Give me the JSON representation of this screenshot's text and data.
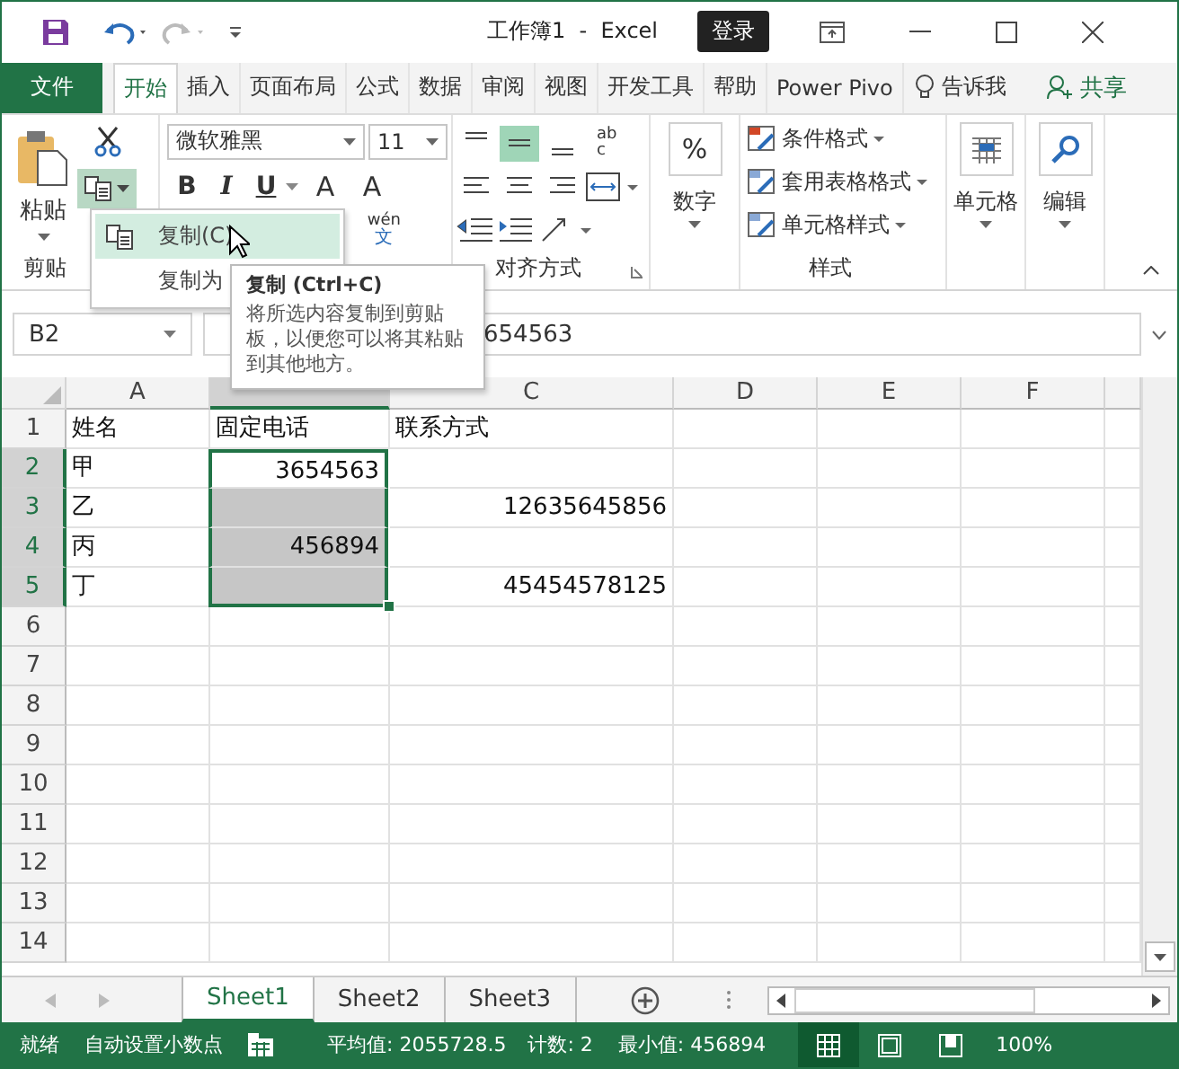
{
  "title_bar": {
    "title": "工作簿1  -  Excel",
    "sign_in": "登录"
  },
  "file_tab": "文件",
  "tabs": [
    {
      "label": "开始",
      "selected": true
    },
    {
      "label": "插入",
      "selected": false
    },
    {
      "label": "页面布局",
      "selected": false
    },
    {
      "label": "公式",
      "selected": false
    },
    {
      "label": "数据",
      "selected": false
    },
    {
      "label": "审阅",
      "selected": false
    },
    {
      "label": "视图",
      "selected": false
    },
    {
      "label": "开发工具",
      "selected": false
    },
    {
      "label": "帮助",
      "selected": false
    },
    {
      "label": "Power Pivo",
      "selected": false
    }
  ],
  "tell_me": "告诉我",
  "share": "共享",
  "ribbon": {
    "paste": "粘贴",
    "clipboard_label": "剪贴",
    "font_name": "微软雅黑",
    "font_size": "11",
    "font_buttons": [
      "B",
      "I",
      "U"
    ],
    "grow_font": "A",
    "shrink_font": "A",
    "phonetic": [
      "wén",
      "文"
    ],
    "wrap_text": [
      "ab",
      "c"
    ],
    "vertical_align": [
      {
        "selected": false
      },
      {
        "selected": true
      },
      {
        "selected": false
      }
    ],
    "alignment_label": "对齐方式",
    "percent": "%",
    "number": "数字",
    "styles": [
      "条件格式",
      "套用表格格式",
      "单元格样式"
    ],
    "styles_label": "样式",
    "cells": "单元格",
    "editing": "编辑"
  },
  "menu": [
    {
      "label": "复制(C)",
      "selected": true
    },
    {
      "label": "复制为",
      "selected": false
    }
  ],
  "tooltip": {
    "title": "复制 (Ctrl+C)",
    "text": "将所选内容复制到剪贴板，以便您可以将其粘贴到其他地方。"
  },
  "formula_bar": {
    "name_box": "B2",
    "value": "654563"
  },
  "sheet": {
    "columns": [
      {
        "label": "A",
        "selected": false
      },
      {
        "selected": true
      },
      {
        "label": "C",
        "selected": false
      },
      {
        "label": "D",
        "selected": false
      },
      {
        "label": "E",
        "selected": false
      },
      {
        "label": "F",
        "selected": false
      }
    ],
    "rows": [
      {
        "header": "1",
        "selected": false,
        "cells": [
          {
            "text": "姓名"
          },
          {
            "text": "固定电话"
          },
          {
            "text": "联系方式"
          }
        ]
      },
      {
        "header": "2",
        "selected": true,
        "cells": [
          {
            "text": "甲"
          },
          {
            "text": "3654563",
            "number": true,
            "selected": true,
            "active": true
          },
          {}
        ]
      },
      {
        "header": "3",
        "selected": true,
        "cells": [
          {
            "text": "乙"
          },
          {
            "selected": true,
            "active": false
          },
          {
            "text": "12635645856",
            "number": true
          }
        ]
      },
      {
        "header": "4",
        "selected": true,
        "cells": [
          {
            "text": "丙"
          },
          {
            "text": "456894",
            "number": true,
            "selected": true,
            "active": false
          },
          {}
        ]
      },
      {
        "header": "5",
        "selected": true,
        "cells": [
          {
            "text": "丁"
          },
          {
            "selected": true,
            "active": false
          },
          {
            "text": "45454578125",
            "number": true
          }
        ]
      },
      {
        "header": "6",
        "selected": false
      },
      {
        "header": "7",
        "selected": false
      },
      {
        "header": "8",
        "selected": false
      },
      {
        "header": "9",
        "selected": false
      },
      {
        "header": "10",
        "selected": false
      },
      {
        "header": "11",
        "selected": false
      },
      {
        "header": "12",
        "selected": false
      },
      {
        "header": "13",
        "selected": false
      },
      {
        "header": "14",
        "selected": false
      }
    ]
  },
  "sheet_tabs": [
    {
      "label": "Sheet1",
      "selected": true
    },
    {
      "label": "Sheet2",
      "selected": false
    },
    {
      "label": "Sheet3",
      "selected": false
    }
  ],
  "status_bar": {
    "ready": "就绪",
    "auto_decimal": "自动设置小数点",
    "average": "平均值: 2055728.5",
    "count": "计数: 2",
    "min": "最小值: 456894",
    "views": [
      {
        "selected": true
      },
      {
        "selected": false
      },
      {
        "selected": false
      }
    ],
    "zoom": "100%"
  }
}
